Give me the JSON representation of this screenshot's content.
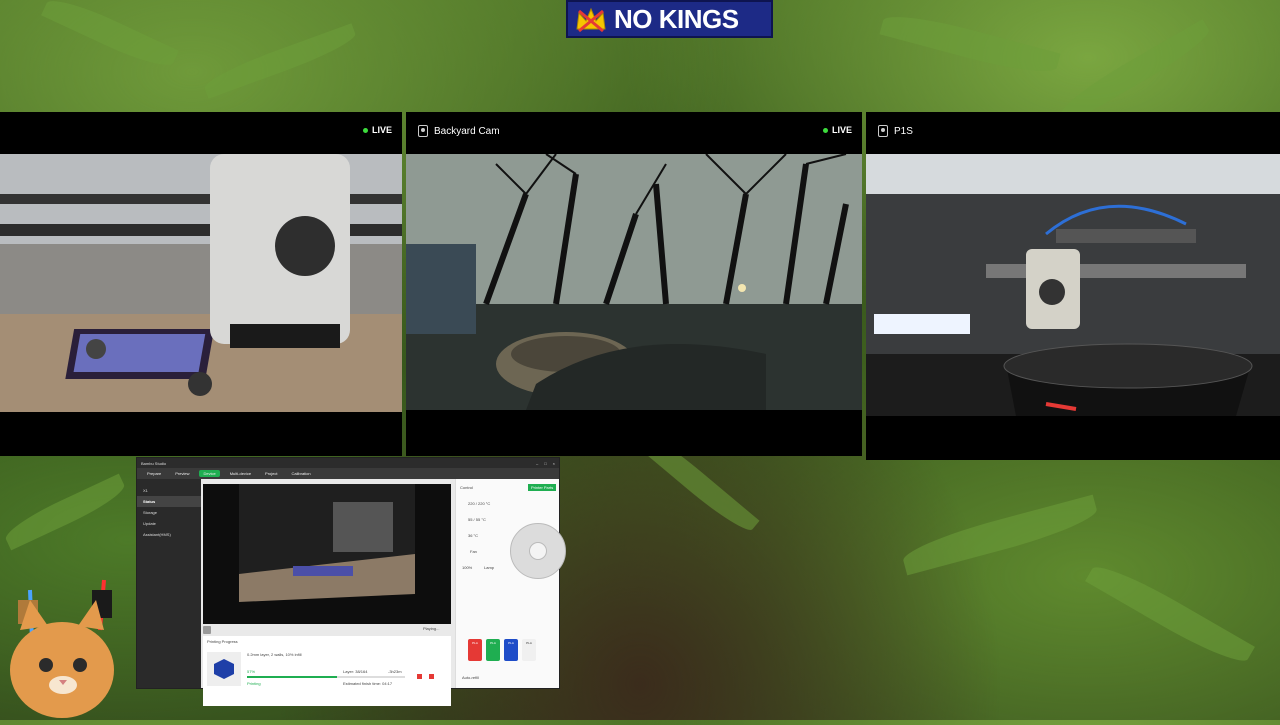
{
  "banner": {
    "text": "NO KINGS"
  },
  "cams": [
    {
      "title": "",
      "live": "LIVE"
    },
    {
      "title": "Backyard Cam",
      "live": "LIVE"
    },
    {
      "title": "P1S",
      "live": ""
    }
  ],
  "studio": {
    "window_title": "Bambu Studio",
    "tabs": [
      "Prepare",
      "Preview",
      "Device",
      "Multi-device",
      "Project",
      "Calibration"
    ],
    "active_tab": "Device",
    "printer": "X1",
    "sidebar": [
      "Status",
      "Storage",
      "Update",
      "Assistant(HMS)"
    ],
    "active_sidebar": "Status",
    "video_status": "Playing...",
    "progress_header": "Printing Progress",
    "job": "0.2mm layer, 2 walls, 10% infill",
    "percent": "57%",
    "percent_value": 0.57,
    "state": "Printing",
    "layer": "Layer: 38/164",
    "time_left": "-3h23m",
    "finish": "Estimated finish time: 04:17",
    "control_label": "Control",
    "printer_parts": "Printer Parts",
    "temps": [
      "220 / 220 °C",
      "55 / 55 °C",
      "36 °C"
    ],
    "fan": "Fan",
    "speed": "100%",
    "lamp": "Lamp",
    "ams_slots": [
      {
        "label": "PLA",
        "color": "#e53935"
      },
      {
        "label": "PLA",
        "color": "#1fae51"
      },
      {
        "label": "PLA",
        "color": "#1e4cc8"
      },
      {
        "label": "PLA",
        "color": "#f0f0f0"
      }
    ],
    "auto_refill": "Auto-refill"
  }
}
